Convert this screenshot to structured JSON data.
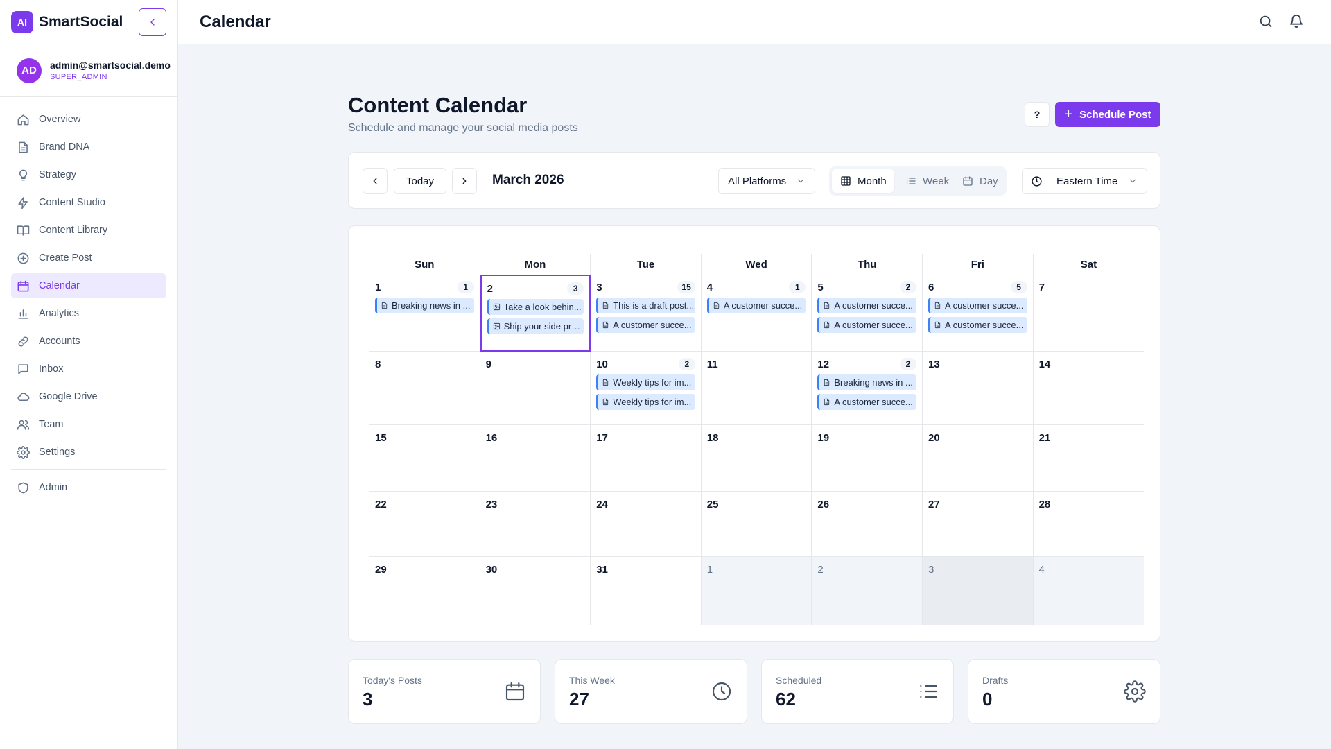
{
  "app": {
    "logo_text": "AI",
    "name": "SmartSocial"
  },
  "user": {
    "initials": "AD",
    "email": "admin@smartsocial.demo",
    "role": "SUPER_ADMIN"
  },
  "nav": [
    {
      "label": "Overview",
      "icon": "home-icon"
    },
    {
      "label": "Brand DNA",
      "icon": "document-icon"
    },
    {
      "label": "Strategy",
      "icon": "lightbulb-icon"
    },
    {
      "label": "Content Studio",
      "icon": "bolt-icon"
    },
    {
      "label": "Content Library",
      "icon": "book-icon"
    },
    {
      "label": "Create Post",
      "icon": "plus-circle-icon"
    },
    {
      "label": "Calendar",
      "icon": "calendar-icon",
      "active": true
    },
    {
      "label": "Analytics",
      "icon": "bar-chart-icon"
    },
    {
      "label": "Accounts",
      "icon": "link-icon"
    },
    {
      "label": "Inbox",
      "icon": "message-icon"
    },
    {
      "label": "Google Drive",
      "icon": "cloud-icon"
    },
    {
      "label": "Team",
      "icon": "users-icon"
    },
    {
      "label": "Settings",
      "icon": "gear-icon"
    },
    {
      "label": "Admin",
      "icon": "shield-icon"
    }
  ],
  "topbar": {
    "title": "Calendar"
  },
  "page": {
    "title": "Content Calendar",
    "subtitle": "Schedule and manage your social media posts",
    "help_label": "?",
    "schedule_label": "Schedule Post"
  },
  "toolbar": {
    "today_label": "Today",
    "month_label": "March 2026",
    "platform_filter": "All Platforms",
    "views": [
      "Month",
      "Week",
      "Day"
    ],
    "active_view": "Month",
    "timezone": "Eastern Time"
  },
  "calendar": {
    "weekdays": [
      "Sun",
      "Mon",
      "Tue",
      "Wed",
      "Thu",
      "Fri",
      "Sat"
    ],
    "weeks": [
      [
        {
          "day": "1",
          "count": "1",
          "events": [
            {
              "text": "Breaking news in ...",
              "icon": "document-icon"
            }
          ]
        },
        {
          "day": "2",
          "count": "3",
          "today": true,
          "events": [
            {
              "text": "Take a look behin...",
              "icon": "image-icon"
            },
            {
              "text": "Ship your side pro...",
              "icon": "image-icon"
            }
          ]
        },
        {
          "day": "3",
          "count": "15",
          "events": [
            {
              "text": "This is a draft post...",
              "icon": "document-icon"
            },
            {
              "text": "A customer succe...",
              "icon": "document-icon"
            }
          ]
        },
        {
          "day": "4",
          "count": "1",
          "events": [
            {
              "text": "A customer succe...",
              "icon": "document-icon"
            }
          ]
        },
        {
          "day": "5",
          "count": "2",
          "events": [
            {
              "text": "A customer succe...",
              "icon": "document-icon"
            },
            {
              "text": "A customer succe...",
              "icon": "document-icon"
            }
          ]
        },
        {
          "day": "6",
          "count": "5",
          "events": [
            {
              "text": "A customer succe...",
              "icon": "document-icon"
            },
            {
              "text": "A customer succe...",
              "icon": "document-icon"
            }
          ]
        },
        {
          "day": "7",
          "events": []
        }
      ],
      [
        {
          "day": "8",
          "events": []
        },
        {
          "day": "9",
          "events": []
        },
        {
          "day": "10",
          "count": "2",
          "events": [
            {
              "text": "Weekly tips for im...",
              "icon": "document-icon"
            },
            {
              "text": "Weekly tips for im...",
              "icon": "document-icon"
            }
          ]
        },
        {
          "day": "11",
          "events": []
        },
        {
          "day": "12",
          "count": "2",
          "events": [
            {
              "text": "Breaking news in ...",
              "icon": "document-icon"
            },
            {
              "text": "A customer succe...",
              "icon": "document-icon"
            }
          ]
        },
        {
          "day": "13",
          "events": []
        },
        {
          "day": "14",
          "events": []
        }
      ],
      [
        {
          "day": "15",
          "events": []
        },
        {
          "day": "16",
          "events": []
        },
        {
          "day": "17",
          "events": []
        },
        {
          "day": "18",
          "events": []
        },
        {
          "day": "19",
          "events": []
        },
        {
          "day": "20",
          "events": []
        },
        {
          "day": "21",
          "events": []
        }
      ],
      [
        {
          "day": "22",
          "events": []
        },
        {
          "day": "23",
          "events": []
        },
        {
          "day": "24",
          "events": []
        },
        {
          "day": "25",
          "events": []
        },
        {
          "day": "26",
          "events": []
        },
        {
          "day": "27",
          "events": []
        },
        {
          "day": "28",
          "events": []
        }
      ],
      [
        {
          "day": "29",
          "events": []
        },
        {
          "day": "30",
          "events": []
        },
        {
          "day": "31",
          "events": []
        },
        {
          "day": "1",
          "outside": true,
          "events": []
        },
        {
          "day": "2",
          "outside": true,
          "events": []
        },
        {
          "day": "3",
          "outside": true,
          "shade": true,
          "events": []
        },
        {
          "day": "4",
          "outside": true,
          "events": []
        }
      ]
    ]
  },
  "stats": [
    {
      "label": "Today's Posts",
      "value": "3",
      "icon": "calendar-icon"
    },
    {
      "label": "This Week",
      "value": "27",
      "icon": "clock-icon"
    },
    {
      "label": "Scheduled",
      "value": "62",
      "icon": "list-icon"
    },
    {
      "label": "Drafts",
      "value": "0",
      "icon": "gear-icon"
    }
  ],
  "colors": {
    "accent": "#7c3aed",
    "event_bg": "#dbeafe",
    "event_border": "#3b82f6"
  }
}
